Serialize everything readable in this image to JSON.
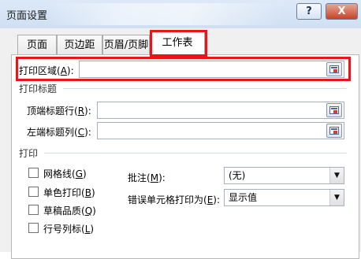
{
  "window": {
    "title": "页面设置",
    "help_label": "?",
    "close_label": "X"
  },
  "tabs": [
    {
      "label": "页面"
    },
    {
      "label": "页边距"
    },
    {
      "label": "页眉/页脚"
    },
    {
      "label": "工作表",
      "active": true
    }
  ],
  "print_area": {
    "label": "打印区域",
    "key": "A",
    "value": ""
  },
  "print_titles": {
    "group_label": "打印标题",
    "rows": {
      "label": "顶端标题行",
      "key": "R",
      "value": ""
    },
    "cols": {
      "label": "左端标题列",
      "key": "C",
      "value": ""
    }
  },
  "print": {
    "group_label": "打印",
    "checkboxes": [
      {
        "label": "网格线",
        "key": "G",
        "checked": false
      },
      {
        "label": "单色打印",
        "key": "B",
        "checked": false
      },
      {
        "label": "草稿品质",
        "key": "Q",
        "checked": false
      },
      {
        "label": "行号列标",
        "key": "L",
        "checked": false
      }
    ],
    "comments": {
      "label": "批注",
      "key": "M",
      "value": "(无)"
    },
    "cell_errors": {
      "label": "错误单元格打印为",
      "key": "E",
      "value": "显示值"
    }
  },
  "colors": {
    "highlight": "#e8151b",
    "dialog_bg": "#f0f0f0"
  }
}
